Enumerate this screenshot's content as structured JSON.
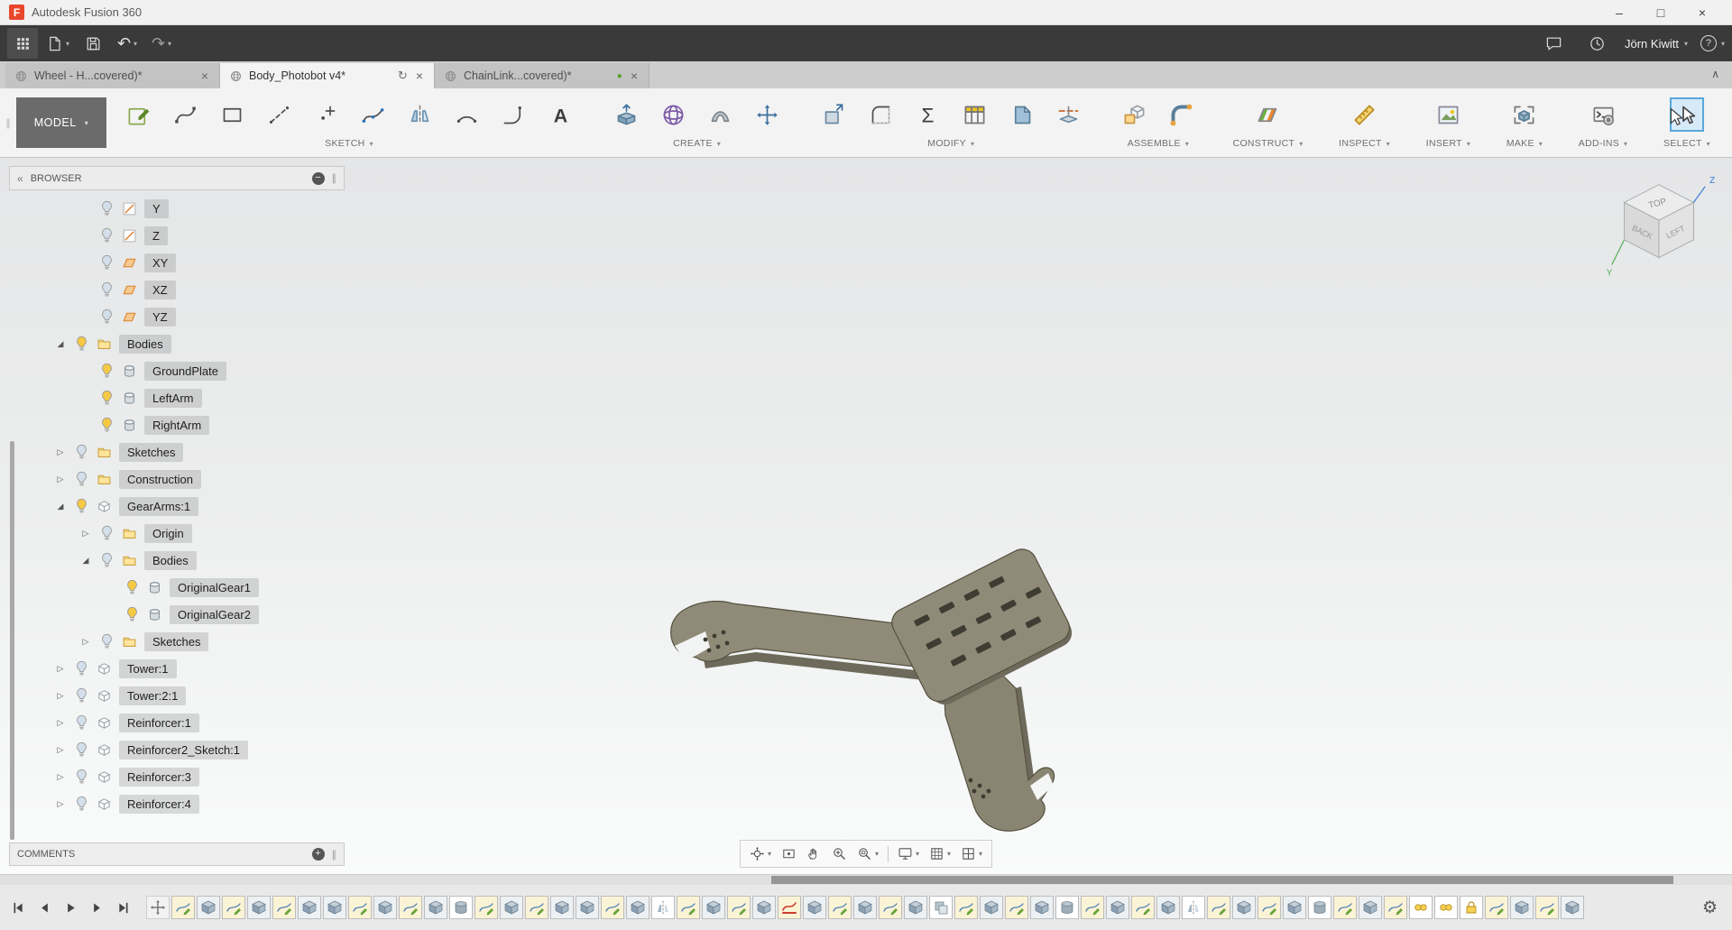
{
  "window": {
    "logo_letter": "F",
    "title": "Autodesk Fusion 360",
    "controls": {
      "minimize": "–",
      "maximize": "□",
      "close": "×"
    }
  },
  "glyphs": {
    "caret": "▾",
    "close": "×",
    "chevron_up": "∧",
    "collapse": "«",
    "grip": "∥",
    "circle_minus": "−",
    "circle_plus": "+",
    "sync": "↻",
    "undo": "↶",
    "redo": "↷",
    "gear": "⚙",
    "green_dot": "●",
    "arrow_open": "◢",
    "arrow_closed": "▷",
    "question": "?"
  },
  "appbar": {
    "user_name": "Jörn Kiwitt",
    "left_buttons": [
      {
        "name": "app-menu-grid",
        "caret": false
      },
      {
        "name": "file",
        "caret": true
      },
      {
        "name": "save",
        "caret": false
      },
      {
        "name": "undo",
        "caret": true
      },
      {
        "name": "redo",
        "caret": true,
        "disabled": true
      }
    ],
    "right_buttons": [
      {
        "name": "comment"
      },
      {
        "name": "clock"
      }
    ]
  },
  "tabs": {
    "items": [
      {
        "label": "Wheel - H...covered)*",
        "active": false,
        "status": "none"
      },
      {
        "label": "Body_Photobot v4*",
        "active": true,
        "status": "sync"
      },
      {
        "label": "ChainLink...covered)*",
        "active": false,
        "status": "green"
      }
    ]
  },
  "ribbon": {
    "workspace": "MODEL",
    "groups": [
      {
        "label": "SKETCH",
        "selected": false,
        "icons": [
          "sketch-create",
          "sketch-spline",
          "sketch-rect",
          "sketch-line",
          "sketch-point",
          "sketch-fit-spline",
          "sketch-mirror",
          "sketch-arc",
          "sketch-tangent-arc",
          "sketch-text"
        ]
      },
      {
        "label": "CREATE",
        "selected": false,
        "icons": [
          "create-extrude",
          "create-form",
          "create-web",
          "create-pattern"
        ]
      },
      {
        "label": "MODIFY",
        "selected": false,
        "icons": [
          "modify-press-pull",
          "modify-fillet",
          "modify-parameters",
          "modify-change-parameters",
          "modify-chamfer",
          "modify-split"
        ]
      },
      {
        "label": "ASSEMBLE",
        "selected": false,
        "icons": [
          "assemble-new-component",
          "assemble-joint"
        ]
      },
      {
        "label": "CONSTRUCT",
        "selected": false,
        "icons": [
          "construct-plane"
        ]
      },
      {
        "label": "INSPECT",
        "selected": false,
        "icons": [
          "inspect-measure"
        ]
      },
      {
        "label": "INSERT",
        "selected": false,
        "icons": [
          "insert-image"
        ]
      },
      {
        "label": "MAKE",
        "selected": false,
        "icons": [
          "make-3d-print"
        ]
      },
      {
        "label": "ADD-INS",
        "selected": false,
        "icons": [
          "addins-scripts"
        ]
      },
      {
        "label": "SELECT",
        "selected": true,
        "icons": [
          "select-cursor"
        ]
      }
    ]
  },
  "browser": {
    "title": "BROWSER",
    "items": [
      {
        "label": "Y",
        "level": 2,
        "icon": "tree-axis",
        "bulb": "off",
        "arrow": "none"
      },
      {
        "label": "Z",
        "level": 2,
        "icon": "tree-axis",
        "bulb": "off",
        "arrow": "none"
      },
      {
        "label": "XY",
        "level": 2,
        "icon": "tree-plane",
        "bulb": "off",
        "arrow": "none"
      },
      {
        "label": "XZ",
        "level": 2,
        "icon": "tree-plane",
        "bulb": "off",
        "arrow": "none"
      },
      {
        "label": "YZ",
        "level": 2,
        "icon": "tree-plane",
        "bulb": "off",
        "arrow": "none"
      },
      {
        "label": "Bodies",
        "level": 1,
        "icon": "tree-folder",
        "bulb": "on",
        "arrow": "open"
      },
      {
        "label": "GroundPlate",
        "level": 2,
        "icon": "tree-body",
        "bulb": "on",
        "arrow": "none"
      },
      {
        "label": "LeftArm",
        "level": 2,
        "icon": "tree-body",
        "bulb": "on",
        "arrow": "none"
      },
      {
        "label": "RightArm",
        "level": 2,
        "icon": "tree-body",
        "bulb": "on",
        "arrow": "none"
      },
      {
        "label": "Sketches",
        "level": 1,
        "icon": "tree-folder",
        "bulb": "off",
        "arrow": "closed"
      },
      {
        "label": "Construction",
        "level": 1,
        "icon": "tree-folder",
        "bulb": "off",
        "arrow": "closed"
      },
      {
        "label": "GearArms:1",
        "level": 1,
        "icon": "tree-component",
        "bulb": "on",
        "arrow": "open"
      },
      {
        "label": "Origin",
        "level": 2,
        "icon": "tree-folder",
        "bulb": "off",
        "arrow": "closed"
      },
      {
        "label": "Bodies",
        "level": 2,
        "icon": "tree-folder",
        "bulb": "off",
        "arrow": "open"
      },
      {
        "label": "OriginalGear1",
        "level": 3,
        "icon": "tree-body",
        "bulb": "on",
        "arrow": "none"
      },
      {
        "label": "OriginalGear2",
        "level": 3,
        "icon": "tree-body",
        "bulb": "on",
        "arrow": "none"
      },
      {
        "label": "Sketches",
        "level": 2,
        "icon": "tree-folder",
        "bulb": "off",
        "arrow": "closed"
      },
      {
        "label": "Tower:1",
        "level": 1,
        "icon": "tree-component",
        "bulb": "off",
        "arrow": "closed"
      },
      {
        "label": "Tower:2:1",
        "level": 1,
        "icon": "tree-component",
        "bulb": "off",
        "arrow": "closed"
      },
      {
        "label": "Reinforcer:1",
        "level": 1,
        "icon": "tree-component",
        "bulb": "off",
        "arrow": "closed"
      },
      {
        "label": "Reinforcer2_Sketch:1",
        "level": 1,
        "icon": "tree-component",
        "bulb": "off",
        "arrow": "closed"
      },
      {
        "label": "Reinforcer:3",
        "level": 1,
        "icon": "tree-component",
        "bulb": "off",
        "arrow": "closed"
      },
      {
        "label": "Reinforcer:4",
        "level": 1,
        "icon": "tree-component",
        "bulb": "off",
        "arrow": "closed"
      }
    ]
  },
  "comments": {
    "title": "COMMENTS"
  },
  "viewcube": {
    "top": "TOP",
    "back": "BACK",
    "left": "LEFT",
    "axis_z": "Z",
    "axis_y": "Y"
  },
  "navbar": {
    "items": [
      {
        "name": "orbit",
        "caret": true
      },
      {
        "name": "look-at",
        "caret": false
      },
      {
        "name": "pan",
        "caret": false
      },
      {
        "name": "zoom",
        "caret": false
      },
      {
        "name": "fit",
        "caret": true
      },
      {
        "name": "divider",
        "caret": false
      },
      {
        "name": "display-settings",
        "caret": true
      },
      {
        "name": "grid-settings",
        "caret": true
      },
      {
        "name": "viewports",
        "caret": true
      }
    ]
  },
  "timeline": {
    "playback": [
      "go-to-start",
      "step-back",
      "play",
      "step-forward",
      "go-to-end"
    ],
    "items": [
      "move",
      "sketch",
      "extrude",
      "sketch",
      "extrude",
      "sketch",
      "extrude",
      "extrude",
      "sketch",
      "extrude",
      "sketch",
      "extrude",
      "hole",
      "sketch",
      "extrude",
      "sketch",
      "extrude",
      "extrude",
      "sketch",
      "extrude",
      "mirror",
      "sketch",
      "extrude",
      "sketch",
      "extrude",
      "warning",
      "extrude",
      "sketch",
      "extrude",
      "sketch",
      "extrude",
      "combine",
      "sketch",
      "extrude",
      "sketch",
      "extrude",
      "hole",
      "sketch",
      "extrude",
      "sketch",
      "extrude",
      "mirror",
      "sketch",
      "extrude",
      "sketch",
      "extrude",
      "hole",
      "sketch",
      "extrude",
      "sketch",
      "joint",
      "joint",
      "lock",
      "sketch",
      "extrude",
      "sketch",
      "extrude"
    ]
  },
  "colors": {
    "accent_blue": "#57a8dc",
    "bulb_on": "#f6c944",
    "bulb_off": "#d3dfea",
    "model_top": "#908b78",
    "model_side": "#6e6a5b",
    "warning_red": "#cc3a2f"
  }
}
